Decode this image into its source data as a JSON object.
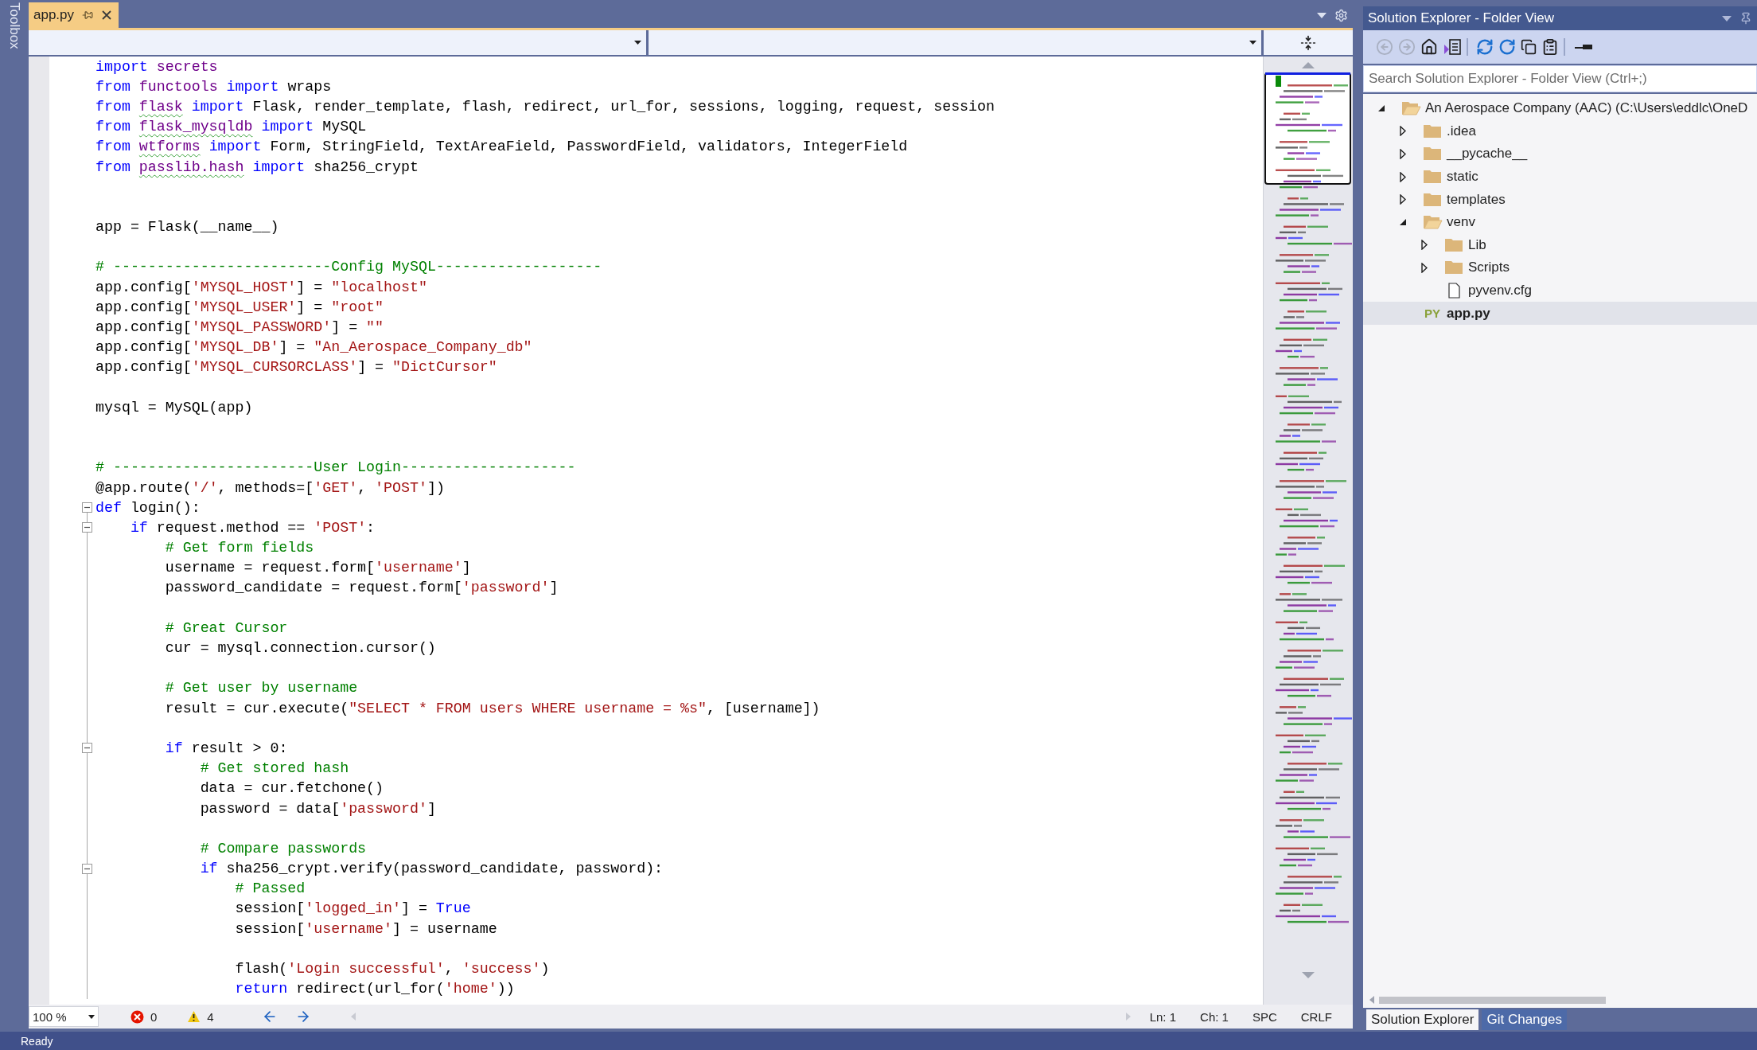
{
  "toolbox": {
    "label": "Toolbox"
  },
  "tabs": [
    {
      "label": "app.py",
      "selected": true
    }
  ],
  "lines": [
    {
      "kind": "code",
      "tokens": [
        {
          "text": "import",
          "kind": "kw"
        },
        {
          "text": " secrets",
          "kind": "mod"
        }
      ]
    },
    {
      "kind": "code",
      "tokens": [
        {
          "text": "from",
          "kind": "kw"
        },
        {
          "text": " functools",
          "kind": "mod"
        },
        {
          "text": " import",
          "kind": "kw"
        },
        {
          "text": " wraps",
          "kind": "txt"
        }
      ]
    },
    {
      "kind": "code",
      "tokens": [
        {
          "text": "from ",
          "kind": "kw"
        },
        {
          "text": "flask",
          "kind": "warn"
        },
        {
          "text": " import ",
          "kind": "kw"
        },
        {
          "text": "Flask, render_template, flash, redirect, url_for, sessions, logging, request, session",
          "kind": "txt"
        }
      ]
    },
    {
      "kind": "code",
      "tokens": [
        {
          "text": "from ",
          "kind": "kw"
        },
        {
          "text": "flask_mysqldb",
          "kind": "warn"
        },
        {
          "text": " import ",
          "kind": "kw"
        },
        {
          "text": "MySQL",
          "kind": "txt"
        }
      ]
    },
    {
      "kind": "code",
      "tokens": [
        {
          "text": "from ",
          "kind": "kw"
        },
        {
          "text": "wtforms",
          "kind": "warn"
        },
        {
          "text": " import ",
          "kind": "kw"
        },
        {
          "text": "Form, StringField, TextAreaField, PasswordField, validators, IntegerField",
          "kind": "txt"
        }
      ]
    },
    {
      "kind": "code",
      "tokens": [
        {
          "text": "from ",
          "kind": "kw"
        },
        {
          "text": "passlib.hash",
          "kind": "warn"
        },
        {
          "text": " import ",
          "kind": "kw"
        },
        {
          "text": "sha256_crypt",
          "kind": "txt"
        }
      ]
    },
    {
      "kind": "blank"
    },
    {
      "kind": "blank"
    },
    {
      "kind": "code",
      "tokens": [
        {
          "text": "app = Flask(__name__)",
          "kind": "txt"
        }
      ]
    },
    {
      "kind": "blank"
    },
    {
      "kind": "code",
      "tokens": [
        {
          "text": "# -------------------------Config MySQL-------------------",
          "kind": "com"
        }
      ]
    },
    {
      "kind": "code",
      "tokens": [
        {
          "text": "app.config[",
          "kind": "txt"
        },
        {
          "text": "'MYSQL_HOST'",
          "kind": "str"
        },
        {
          "text": "] = ",
          "kind": "txt"
        },
        {
          "text": "\"localhost\"",
          "kind": "str"
        }
      ]
    },
    {
      "kind": "code",
      "tokens": [
        {
          "text": "app.config[",
          "kind": "txt"
        },
        {
          "text": "'MYSQL_USER'",
          "kind": "str"
        },
        {
          "text": "] = ",
          "kind": "txt"
        },
        {
          "text": "\"root\"",
          "kind": "str"
        }
      ]
    },
    {
      "kind": "code",
      "tokens": [
        {
          "text": "app.config[",
          "kind": "txt"
        },
        {
          "text": "'MYSQL_PASSWORD'",
          "kind": "str"
        },
        {
          "text": "] = ",
          "kind": "txt"
        },
        {
          "text": "\"\"",
          "kind": "str"
        }
      ]
    },
    {
      "kind": "code",
      "tokens": [
        {
          "text": "app.config[",
          "kind": "txt"
        },
        {
          "text": "'MYSQL_DB'",
          "kind": "str"
        },
        {
          "text": "] = ",
          "kind": "txt"
        },
        {
          "text": "\"An_Aerospace_Company_db\"",
          "kind": "str"
        }
      ]
    },
    {
      "kind": "code",
      "tokens": [
        {
          "text": "app.config[",
          "kind": "txt"
        },
        {
          "text": "'MYSQL_CURSORCLASS'",
          "kind": "str"
        },
        {
          "text": "] = ",
          "kind": "txt"
        },
        {
          "text": "\"DictCursor\"",
          "kind": "str"
        }
      ]
    },
    {
      "kind": "blank"
    },
    {
      "kind": "code",
      "tokens": [
        {
          "text": "mysql = MySQL(app)",
          "kind": "txt"
        }
      ]
    },
    {
      "kind": "blank"
    },
    {
      "kind": "blank"
    },
    {
      "kind": "code",
      "tokens": [
        {
          "text": "# -----------------------User Login--------------------",
          "kind": "com"
        }
      ]
    },
    {
      "kind": "code",
      "tokens": [
        {
          "text": "@app.route(",
          "kind": "txt"
        },
        {
          "text": "'/'",
          "kind": "str"
        },
        {
          "text": ", methods=[",
          "kind": "txt"
        },
        {
          "text": "'GET'",
          "kind": "str"
        },
        {
          "text": ", ",
          "kind": "txt"
        },
        {
          "text": "'POST'",
          "kind": "str"
        },
        {
          "text": "])",
          "kind": "txt"
        }
      ]
    },
    {
      "kind": "fold",
      "tokens": [
        {
          "text": "def",
          "kind": "kw"
        },
        {
          "text": " login():",
          "kind": "txt"
        }
      ]
    },
    {
      "kind": "fold",
      "tokens": [
        {
          "text": "    if",
          "kind": "kw"
        },
        {
          "text": " request.method == ",
          "kind": "txt"
        },
        {
          "text": "'POST'",
          "kind": "str"
        },
        {
          "text": ":",
          "kind": "txt"
        }
      ]
    },
    {
      "kind": "code",
      "tokens": [
        {
          "text": "        # Get form fields",
          "kind": "com"
        }
      ]
    },
    {
      "kind": "code",
      "tokens": [
        {
          "text": "        username = request.form[",
          "kind": "txt"
        },
        {
          "text": "'username'",
          "kind": "str"
        },
        {
          "text": "]",
          "kind": "txt"
        }
      ]
    },
    {
      "kind": "code",
      "tokens": [
        {
          "text": "        password_candidate = request.form[",
          "kind": "txt"
        },
        {
          "text": "'password'",
          "kind": "str"
        },
        {
          "text": "]",
          "kind": "txt"
        }
      ]
    },
    {
      "kind": "blank"
    },
    {
      "kind": "code",
      "tokens": [
        {
          "text": "        # Great Cursor",
          "kind": "com"
        }
      ]
    },
    {
      "kind": "code",
      "tokens": [
        {
          "text": "        cur = mysql.connection.cursor()",
          "kind": "txt"
        }
      ]
    },
    {
      "kind": "blank"
    },
    {
      "kind": "code",
      "tokens": [
        {
          "text": "        # Get user by username",
          "kind": "com"
        }
      ]
    },
    {
      "kind": "code",
      "tokens": [
        {
          "text": "        result = cur.execute(",
          "kind": "txt"
        },
        {
          "text": "\"SELECT * FROM users WHERE username = %s\"",
          "kind": "str"
        },
        {
          "text": ", [username])",
          "kind": "txt"
        }
      ]
    },
    {
      "kind": "blank"
    },
    {
      "kind": "fold",
      "tokens": [
        {
          "text": "        if",
          "kind": "kw"
        },
        {
          "text": " result > 0:",
          "kind": "txt"
        }
      ]
    },
    {
      "kind": "code",
      "tokens": [
        {
          "text": "            # Get stored hash",
          "kind": "com"
        }
      ]
    },
    {
      "kind": "code",
      "tokens": [
        {
          "text": "            data = cur.fetchone()",
          "kind": "txt"
        }
      ]
    },
    {
      "kind": "code",
      "tokens": [
        {
          "text": "            password = data[",
          "kind": "txt"
        },
        {
          "text": "'password'",
          "kind": "str"
        },
        {
          "text": "]",
          "kind": "txt"
        }
      ]
    },
    {
      "kind": "blank"
    },
    {
      "kind": "code",
      "tokens": [
        {
          "text": "            # Compare passwords",
          "kind": "com"
        }
      ]
    },
    {
      "kind": "fold",
      "tokens": [
        {
          "text": "            if",
          "kind": "kw"
        },
        {
          "text": " sha256_crypt.verify(password_candidate, password):",
          "kind": "txt"
        }
      ]
    },
    {
      "kind": "code",
      "tokens": [
        {
          "text": "                # Passed",
          "kind": "com"
        }
      ]
    },
    {
      "kind": "code",
      "tokens": [
        {
          "text": "                session[",
          "kind": "txt"
        },
        {
          "text": "'logged_in'",
          "kind": "str"
        },
        {
          "text": "] = ",
          "kind": "txt"
        },
        {
          "text": "True",
          "kind": "kw"
        }
      ]
    },
    {
      "kind": "code",
      "tokens": [
        {
          "text": "                session[",
          "kind": "txt"
        },
        {
          "text": "'username'",
          "kind": "str"
        },
        {
          "text": "] = username",
          "kind": "txt"
        }
      ]
    },
    {
      "kind": "blank"
    },
    {
      "kind": "code",
      "tokens": [
        {
          "text": "                flash(",
          "kind": "txt"
        },
        {
          "text": "'Login successful'",
          "kind": "str"
        },
        {
          "text": ", ",
          "kind": "txt"
        },
        {
          "text": "'success'",
          "kind": "str"
        },
        {
          "text": ")",
          "kind": "txt"
        }
      ]
    },
    {
      "kind": "code",
      "tokens": [
        {
          "text": "                return",
          "kind": "kw"
        },
        {
          "text": " redirect(url_for(",
          "kind": "txt"
        },
        {
          "text": "'home'",
          "kind": "str"
        },
        {
          "text": "))",
          "kind": "txt"
        }
      ]
    }
  ],
  "editor_status": {
    "zoom": "100 %",
    "errors": "0",
    "warnings": "4",
    "line": "Ln: 1",
    "char": "Ch: 1",
    "indent": "SPC",
    "eol": "CRLF"
  },
  "solution_explorer": {
    "title": "Solution Explorer - Folder View",
    "toolbar": [
      [
        {
          "kind": "back",
          "disabled": true
        },
        {
          "kind": "forward",
          "disabled": true
        },
        {
          "kind": "home",
          "disabled": false
        },
        {
          "kind": "views",
          "disabled": false
        }
      ],
      [
        {
          "kind": "sync",
          "disabled": false
        },
        {
          "kind": "refresh",
          "disabled": false
        },
        {
          "kind": "collapse",
          "disabled": false
        },
        {
          "kind": "properties",
          "disabled": false
        }
      ],
      [
        {
          "kind": "preview",
          "disabled": false
        }
      ]
    ],
    "search": {
      "placeholder": "Search Solution Explorer - Folder View (Ctrl+;)"
    },
    "tree": [
      {
        "label": "An Aerospace Company (AAC) (C:\\Users\\eddlc\\OneD",
        "kind": "folder",
        "expanded": true,
        "selected": false,
        "children": [
          {
            "label": ".idea",
            "kind": "folder",
            "expanded": false,
            "selected": false
          },
          {
            "label": "__pycache__",
            "kind": "folder",
            "expanded": false,
            "selected": false
          },
          {
            "label": "static",
            "kind": "folder",
            "expanded": false,
            "selected": false
          },
          {
            "label": "templates",
            "kind": "folder",
            "expanded": false,
            "selected": false
          },
          {
            "label": "venv",
            "kind": "folder",
            "expanded": true,
            "selected": false,
            "children": [
              {
                "label": "Lib",
                "kind": "folder",
                "expanded": false,
                "selected": false
              },
              {
                "label": "Scripts",
                "kind": "folder",
                "expanded": false,
                "selected": false
              },
              {
                "label": "pyvenv.cfg",
                "kind": "file",
                "selected": false
              }
            ]
          },
          {
            "label": "app.py",
            "kind": "python",
            "badge": "PY",
            "selected": true
          }
        ]
      }
    ],
    "tabs": [
      {
        "label": "Solution Explorer",
        "selected": true
      },
      {
        "label": "Git Changes",
        "selected": false
      }
    ]
  },
  "status_bar": {
    "text": "Ready"
  }
}
